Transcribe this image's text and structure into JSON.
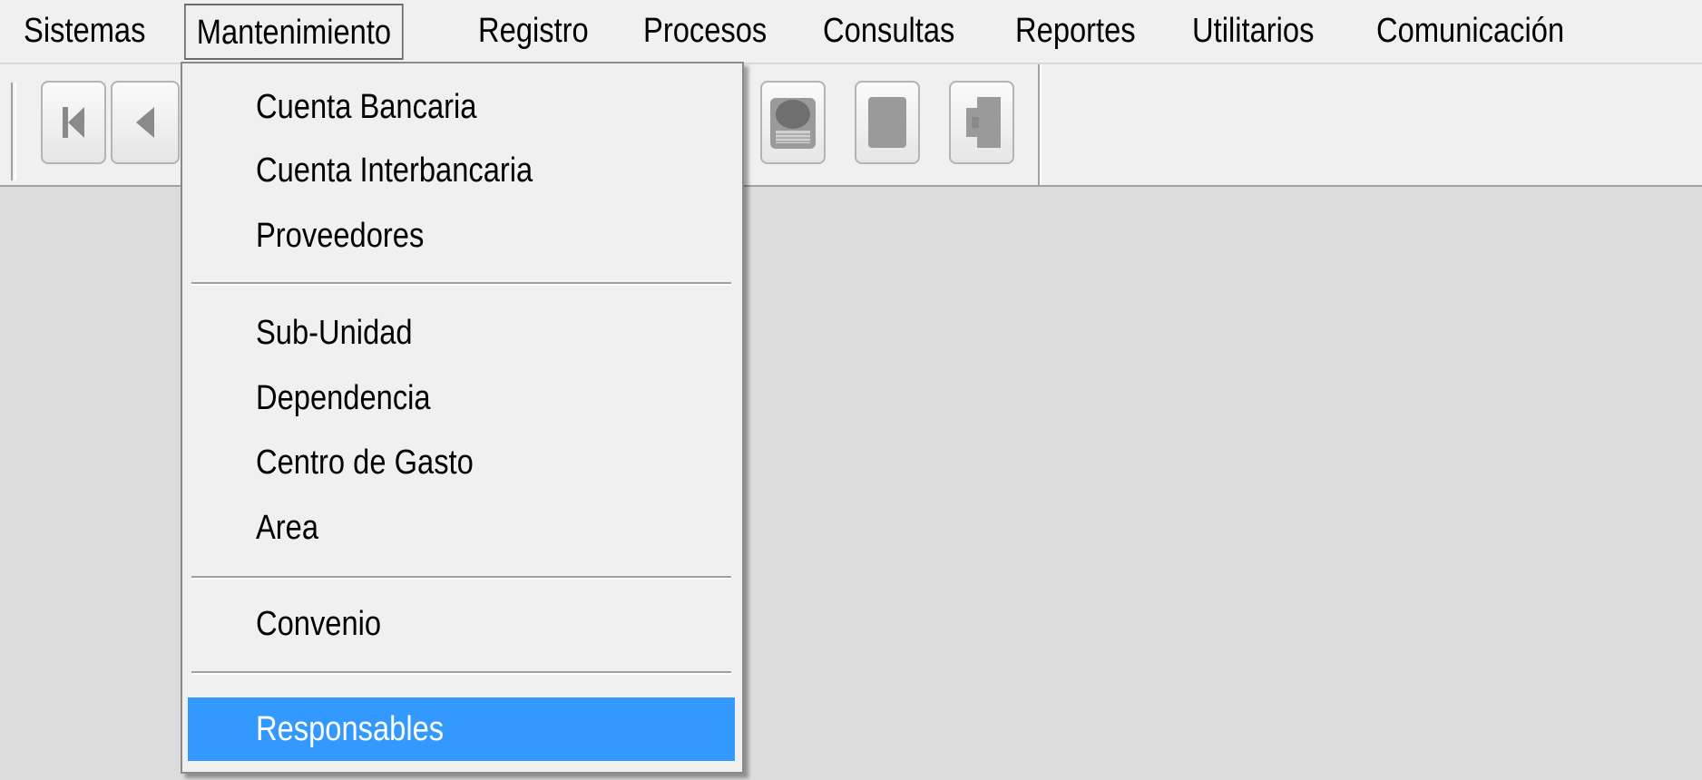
{
  "menubar": {
    "items": [
      {
        "label": "Sistemas"
      },
      {
        "label": "Mantenimiento"
      },
      {
        "label": "Registro"
      },
      {
        "label": "Procesos"
      },
      {
        "label": "Consultas"
      },
      {
        "label": "Reportes"
      },
      {
        "label": "Utilitarios"
      },
      {
        "label": "Comunicación"
      }
    ],
    "open_menu": "Mantenimiento"
  },
  "toolbar": {
    "buttons": [
      {
        "icon": "first-record-icon"
      },
      {
        "icon": "previous-record-icon"
      },
      {
        "icon": "printer-icon"
      },
      {
        "icon": "document-icon"
      },
      {
        "icon": "exit-door-icon"
      }
    ]
  },
  "dropdown": {
    "items": [
      {
        "label": "Cuenta Bancaria"
      },
      {
        "label": "Cuenta Interbancaria"
      },
      {
        "label": "Proveedores"
      },
      {
        "label": "Sub-Unidad"
      },
      {
        "label": "Dependencia"
      },
      {
        "label": "Centro de Gasto"
      },
      {
        "label": "Area"
      },
      {
        "label": "Convenio"
      },
      {
        "label": "Responsables"
      }
    ],
    "highlighted_item": "Responsables"
  },
  "colors": {
    "menu_background": "#f0f0f0",
    "workspace_background": "#dcdcdc",
    "highlight": "#3399ff",
    "highlight_text": "#ffffff"
  }
}
